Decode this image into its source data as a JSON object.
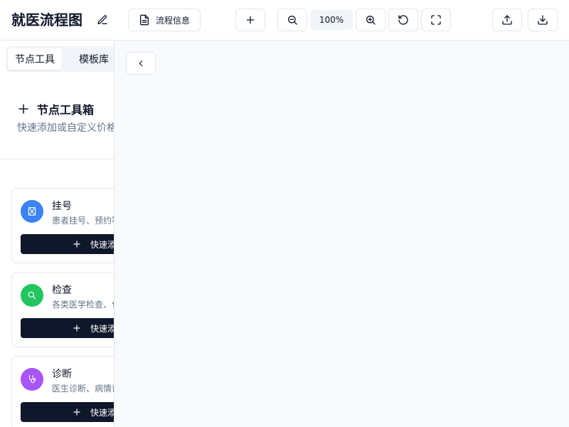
{
  "header": {
    "title": "就医流程图",
    "info_button_label": "流程信息",
    "zoom_level": "100%"
  },
  "sidebar": {
    "tabs": [
      {
        "label": "节点工具",
        "active": true
      },
      {
        "label": "模板库",
        "active": false
      }
    ],
    "toolbox": {
      "title": "节点工具箱",
      "description": "快速添加或自定义价格"
    },
    "nodes": [
      {
        "title": "挂号",
        "description": "患者挂号、预约等",
        "button_label": "快速添加",
        "icon": "hourglass-icon",
        "color": "#3b82f6"
      },
      {
        "title": "检查",
        "description": "各类医学检查、化验",
        "button_label": "快速添加",
        "icon": "search-icon",
        "color": "#22c55e"
      },
      {
        "title": "诊断",
        "description": "医生诊断、病情评估",
        "button_label": "快速添加",
        "icon": "stethoscope-icon",
        "color": "#a855f7"
      }
    ]
  },
  "colors": {
    "primary_button": "#0f172a",
    "canvas_bg": "#f8fafc"
  }
}
